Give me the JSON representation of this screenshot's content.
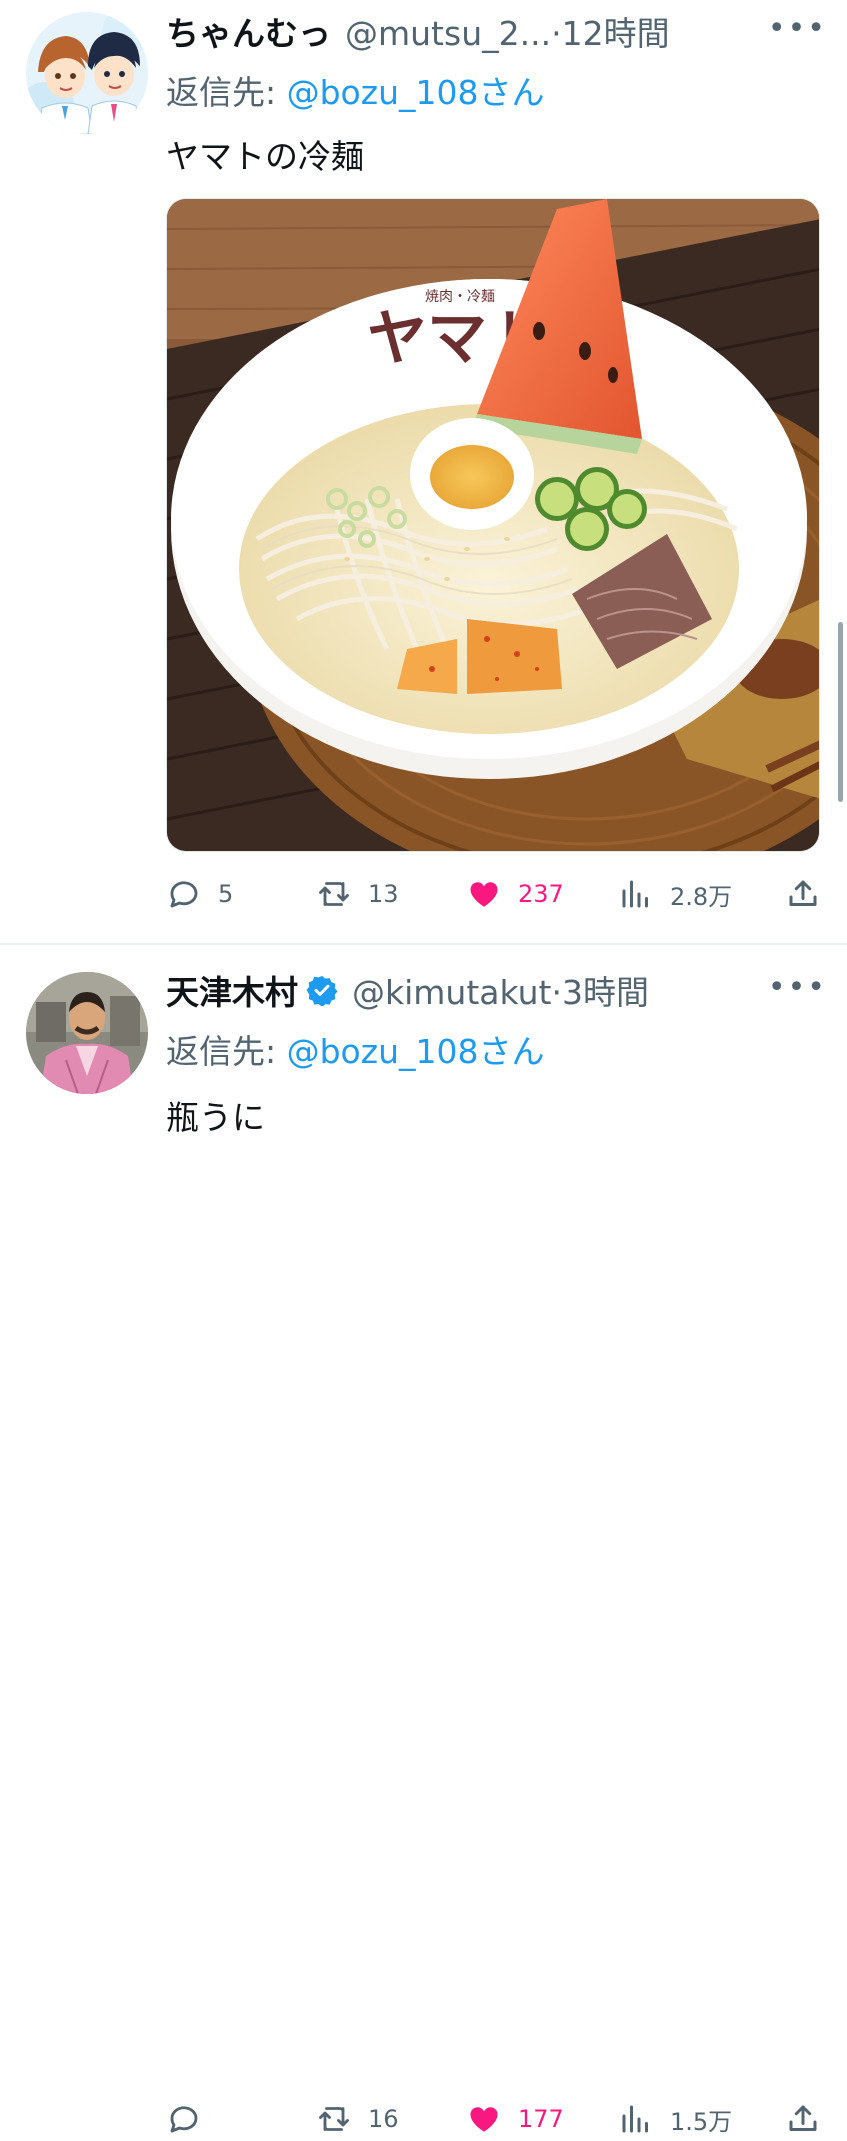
{
  "tweets": [
    {
      "name": "ちゃんむっ",
      "handle": "@mutsu_2...",
      "time": "12時間",
      "reply_prefix": "返信先: ",
      "reply_mention": "@bozu_108さん",
      "text": "ヤマトの冷麺",
      "media": {
        "bowl_logo_small": "焼肉・冷麺",
        "bowl_logo": "ヤマト"
      },
      "stats": {
        "replies": "5",
        "retweets": "13",
        "likes": "237",
        "views": "2.8万"
      },
      "liked": true
    },
    {
      "name": "天津木村",
      "verified": true,
      "handle": "@kimutakut",
      "time": "3時間",
      "reply_prefix": "返信先: ",
      "reply_mention": "@bozu_108さん",
      "text": "瓶うに",
      "stats": {
        "replies": "",
        "retweets": "16",
        "likes": "177",
        "views": "1.5万"
      },
      "liked": true
    }
  ],
  "ui": {
    "more_label": "•••",
    "dot": "·"
  },
  "colors": {
    "accent": "#1d9bf0",
    "like": "#f91880",
    "muted": "#536471",
    "text": "#0f1419"
  }
}
